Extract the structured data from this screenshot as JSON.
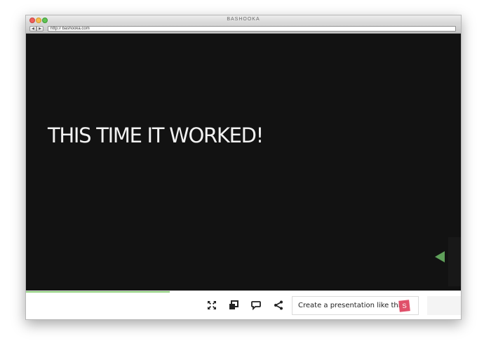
{
  "window": {
    "title": "BASHOOKA"
  },
  "browser": {
    "back_glyph": "◀",
    "forward_glyph": "▶",
    "url": "http:// bashooka.com"
  },
  "slide": {
    "heading": "THIS TIME IT WORKED!",
    "background": "#121212",
    "text_color": "#f2f2f2",
    "nav_arrow_color": "#5fa05a"
  },
  "footer": {
    "progress_fraction": 0.33,
    "progress_color": "#8fd07d",
    "icons": [
      "fullscreen-icon",
      "embed-icon",
      "comment-icon",
      "share-icon"
    ],
    "cta_label": "Create a presentation like this",
    "cta_logo_text": "S",
    "logo_color": "#e0506a"
  }
}
